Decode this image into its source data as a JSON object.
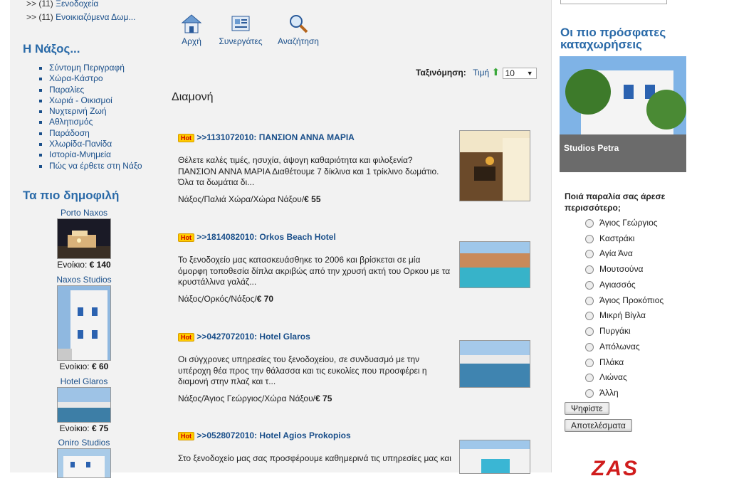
{
  "categories": [
    {
      "prefix": ">> (11)",
      "label": "Ξενοδοχεία"
    },
    {
      "prefix": ">> (11)",
      "label": "Ενοικιαζόμενα Δωμ..."
    }
  ],
  "naxos_section": {
    "title": "Η Νάξος...",
    "links": [
      "Σύντομη Περιγραφή",
      "Χώρα-Κάστρο",
      "Παραλίες",
      "Χωριά - Οικισμοί",
      "Νυχτερινή Ζωή",
      "Αθλητισμός",
      "Παράδοση",
      "Χλωρίδα-Πανίδα",
      "Ιστορία-Μνημεία",
      "Πώς να έρθετε στη Νάξο"
    ]
  },
  "popular": {
    "title": "Τα πιο δημοφιλή",
    "items": [
      {
        "name": "Porto Naxos",
        "price_label": "Ενοίκιο:",
        "price": "€ 140"
      },
      {
        "name": "Naxos Studios",
        "price_label": "Ενοίκιο:",
        "price": "€ 60"
      },
      {
        "name": "Hotel Glaros",
        "price_label": "Ενοίκιο:",
        "price": "€ 75"
      },
      {
        "name": "Oniro Studios"
      }
    ]
  },
  "toolbar": {
    "home": "Αρχή",
    "partners": "Συνεργάτες",
    "search": "Αναζήτηση"
  },
  "sort": {
    "label": "Ταξινόμηση:",
    "field": "Τιμή",
    "value": "10"
  },
  "main": {
    "heading": "Διαμονή",
    "hot_badge": "Hot",
    "listings": [
      {
        "title": ">>1131072010: ΠΑΝΣΙΟΝ ΑΝΝΑ ΜΑΡΙΑ",
        "desc": "Θέλετε καλές τιμές, ησυχία, άψογη καθαριότητα και φιλοξενία? ΠΑΝΣΙΟΝ ΑΝΝΑ ΜΑΡΙΑ Διαθέτουμε 7 δίκλινα και 1 τρίκλινο δωμάτιο. Όλα τα δωμάτια δι...",
        "location": "Νάξος/Παλιά Χώρα/Χώρα Νάξου/",
        "price": "€ 55"
      },
      {
        "title": ">>1814082010: Orkos Beach Hotel",
        "desc": "Το ξενοδοχείο μας κατασκευάσθηκε το 2006 και βρίσκεται σε μία όμορφη τοποθεσία δίπλα ακριβώς από την χρυσή ακτή του Ορκου με τα κρυστάλλινα γαλάζ...",
        "location": "Νάξος/Ορκός/Νάξος/",
        "price": "€ 70"
      },
      {
        "title": ">>0427072010: Hotel Glaros",
        "desc": "Οι σύγχρονες υπηρεσίες του ξενοδοχείου, σε συνδυασμό με την υπέροχη θέα προς την θάλασσα και τις ευκολίες που προσφέρει η διαμονή στην πλαζ και τ...",
        "location": "Νάξος/Άγιος Γεώργιος/Χώρα Νάξου/",
        "price": "€ 75"
      },
      {
        "title": ">>0528072010: Hotel Agios Prokopios",
        "desc": "Στο ξενοδοχείο μας σας προσφέρουμε καθημερινά τις υπηρεσίες μας και",
        "location": "",
        "price": ""
      }
    ]
  },
  "right": {
    "recent_title": "Οι πιο πρόσφατες καταχωρήσεις",
    "recent_caption": "Studios Petra",
    "poll_question": "Ποιά παραλία σας άρεσε περισσότερο;",
    "poll_options": [
      "Άγιος Γεώργιος",
      "Καστράκι",
      "Αγία Άνα",
      "Μουτσούνα",
      "Αγιασσός",
      "Άγιος Προκόπιος",
      "Μικρή Βίγλα",
      "Πυργάκι",
      "Απόλωνας",
      "Πλάκα",
      "Λιώνας",
      "Άλλη"
    ],
    "vote_button": "Ψηφίστε",
    "results_button": "Αποτελέσματα",
    "sponsor_logo": "ZAS"
  },
  "colors": {
    "link": "#1a4f8a",
    "heading": "#2a6aa8",
    "hot_bg": "#ffcc00",
    "logo_red": "#d01c1c"
  }
}
